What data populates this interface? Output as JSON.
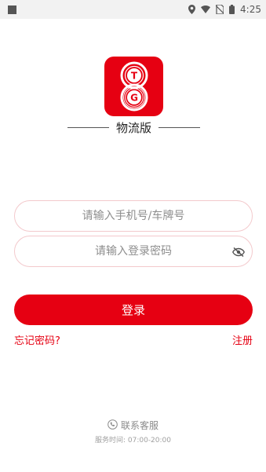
{
  "status_bar": {
    "time": "4:25"
  },
  "brand": {
    "subtitle": "物流版",
    "logo_letters": [
      "T",
      "G"
    ],
    "color": "#e60012"
  },
  "login_form": {
    "phone_placeholder": "请输入手机号/车牌号",
    "password_placeholder": "请输入登录密码",
    "phone_value": "",
    "password_value": "",
    "login_label": "登录",
    "forgot_label": "忘记密码?",
    "register_label": "注册"
  },
  "footer": {
    "service_label": "联系客服",
    "service_hours": "服务时间: 07:00-20:00"
  },
  "icons": {
    "status": [
      "notification-square-icon",
      "location-icon",
      "wifi-icon",
      "no-sim-icon",
      "battery-icon"
    ],
    "password_toggle": "eye-off-icon",
    "service": "phone-icon"
  }
}
